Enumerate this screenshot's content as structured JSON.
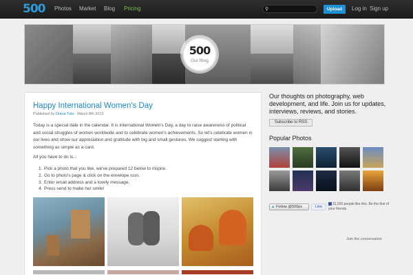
{
  "header": {
    "logo": "500",
    "nav": [
      "Photos",
      "Market",
      "Blog",
      "Pricing"
    ],
    "upload_label": "Upload",
    "login_label": "Log in",
    "signup_label": "Sign up",
    "search_value": ""
  },
  "banner": {
    "badge_logo": "500",
    "badge_sub": "Our Blog"
  },
  "post": {
    "title": "Happy International Women's Day",
    "byline_prefix": "Published by",
    "author": "Diana Tula",
    "byline_date": "· March 8th 2013",
    "p1_line1": "Today is a special date in the calendar. It is International Women's Day, a day to raise awareness of political",
    "p1_line2": "and social struggles of women worldwide and to celebrate women's achievements. So let's celebrate women in",
    "p1_line3": "our lives and show our appreciation and gratitude with big and small gestures. We suggest starting with",
    "p1_line4": "something as simple as a card.",
    "p2": "All you have to do is...",
    "steps": [
      "Pick a photo that you like, we've prepared 12 below to inspire.",
      "Go to photo's page & click on the envelope icon.",
      "Enter email address and a lovely message.",
      "Press send to make her smile!"
    ],
    "photos": [
      "box-robots-photo",
      "bear-cubs-photo",
      "foxes-photo"
    ]
  },
  "sidebar": {
    "tagline": "Our thoughts on photography, web development, and life. Join us for updates, interviews, reviews, and stories.",
    "rss_label": "Subscribe to RSS",
    "popular_title": "Popular Photos",
    "follow_label": "Follow @500px",
    "like_label": "Like",
    "like_text": "31,920 people like this. Be the first of your friends.",
    "join_label": "Join the conversation"
  },
  "colors": {
    "accent": "#1c88c7",
    "upload": "#1f8fd6",
    "pricing": "#7cc24a",
    "topbar": "#222222"
  }
}
